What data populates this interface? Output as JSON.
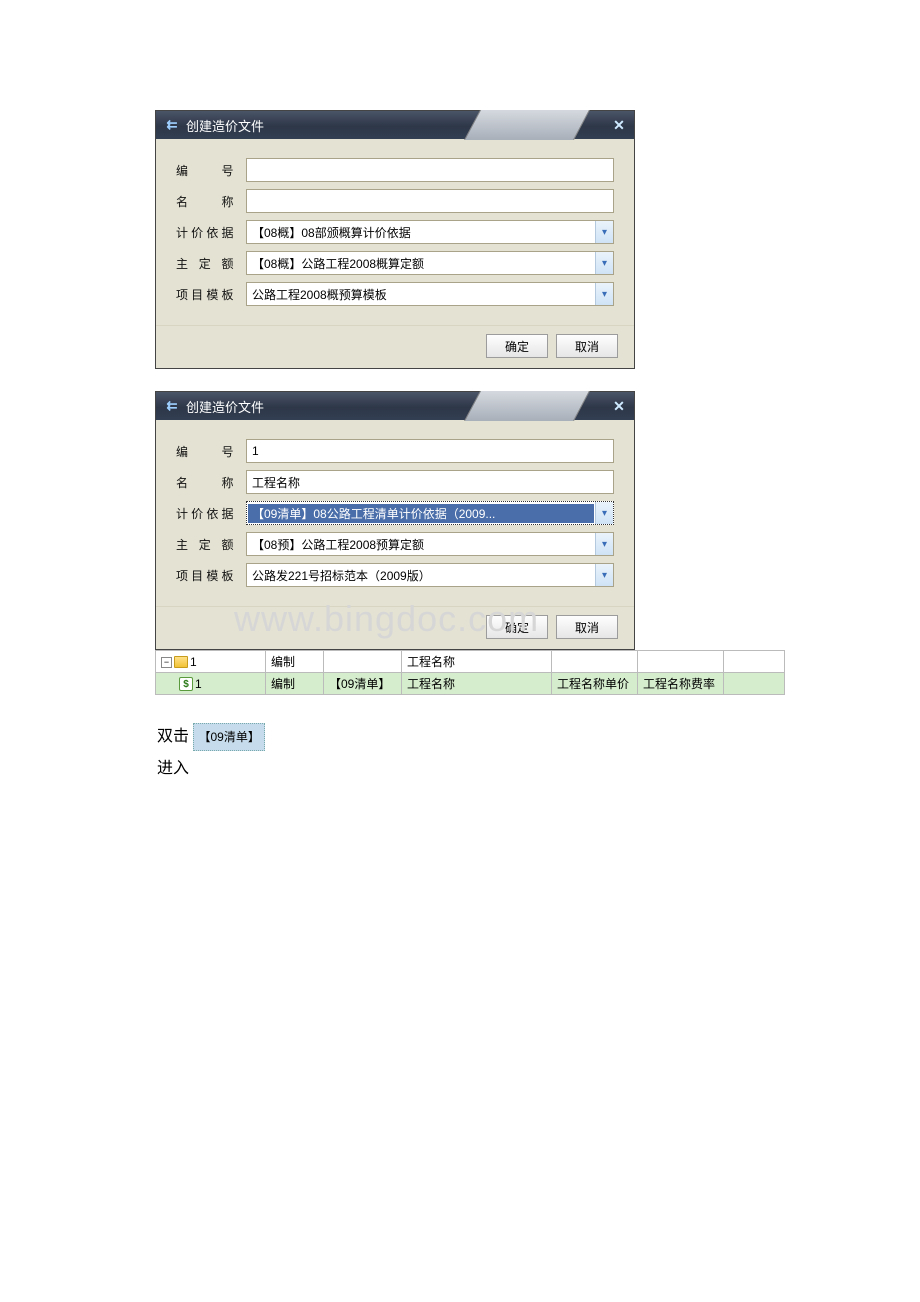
{
  "dialog1": {
    "title": "创建造价文件",
    "labels": {
      "number": "编　　号",
      "name": "名　　称",
      "basis": "计价依据",
      "quota": "主 定 额",
      "template": "项目模板"
    },
    "values": {
      "number": "",
      "name": "",
      "basis": "【08概】08部颁概算计价依据",
      "quota": "【08概】公路工程2008概算定额",
      "template": "公路工程2008概预算模板"
    },
    "buttons": {
      "ok": "确定",
      "cancel": "取消"
    }
  },
  "dialog2": {
    "title": "创建造价文件",
    "labels": {
      "number": "编　　号",
      "name": "名　　称",
      "basis": "计价依据",
      "quota": "主 定 额",
      "template": "项目模板"
    },
    "values": {
      "number": "1",
      "name": "工程名称",
      "basis": "【09清单】08公路工程清单计价依据（2009...",
      "quota": "【08预】公路工程2008预算定额",
      "template": "公路发221号招标范本（2009版）"
    },
    "buttons": {
      "ok": "确定",
      "cancel": "取消"
    }
  },
  "tree": {
    "row1": {
      "c1": "1",
      "c2": "编制",
      "c3": "",
      "c4": "工程名称",
      "c5": "",
      "c6": ""
    },
    "row2": {
      "c1": "1",
      "c2": "编制",
      "c3": "【09清单】",
      "c4": "工程名称",
      "c5": "工程名称单价",
      "c6": "工程名称费率"
    }
  },
  "instructions": {
    "line1_prefix": "双击",
    "line1_chip": "【09清单】",
    "line2": "进入"
  },
  "watermark": "www.bingdoc.com"
}
